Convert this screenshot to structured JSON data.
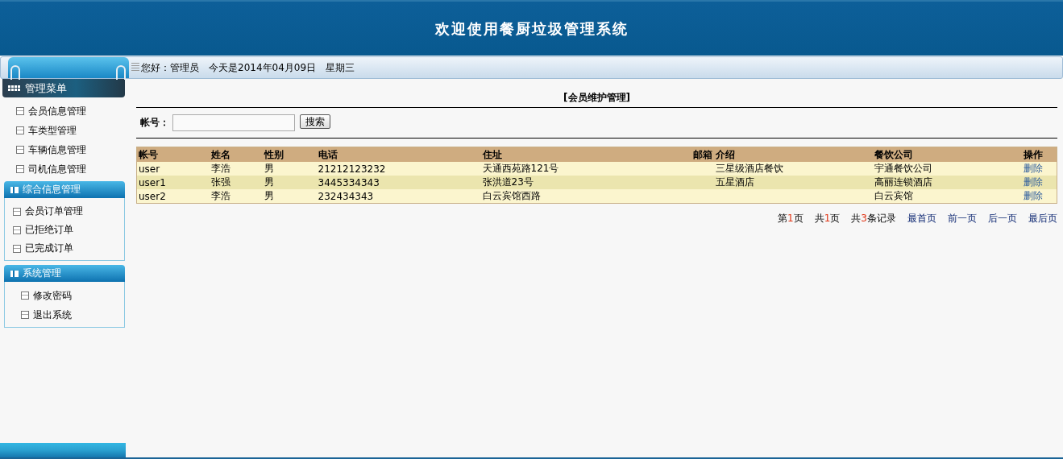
{
  "header": {
    "title": "欢迎使用餐厨垃圾管理系统"
  },
  "topbar": {
    "greeting": "您好：管理员",
    "date": "今天是2014年04月09日",
    "weekday": "星期三"
  },
  "sidebar": {
    "menu_title": "管理菜单",
    "items": [
      "会员信息管理",
      "车类型管理",
      "车辆信息管理",
      "司机信息管理"
    ],
    "sections": [
      {
        "title": "综合信息管理",
        "items": [
          "会员订单管理",
          "已拒绝订单",
          "已完成订单"
        ]
      },
      {
        "title": "系统管理",
        "items": [
          "修改密码",
          "退出系统"
        ]
      }
    ]
  },
  "main": {
    "title": "[会员维护管理]",
    "search": {
      "label": "帐号：",
      "button": "搜索"
    },
    "table": {
      "columns": [
        "帐号",
        "姓名",
        "性别",
        "电话",
        "住址",
        "邮箱",
        "介绍",
        "餐饮公司",
        "操作"
      ],
      "rows": [
        [
          "user",
          "李浩",
          "男",
          "21212123232",
          "天通西苑路121号",
          "",
          "三星级酒店餐饮",
          "宇通餐饮公司",
          "删除"
        ],
        [
          "user1",
          "张强",
          "男",
          "3445334343",
          "张洪道23号",
          "",
          "五星酒店",
          "高丽连锁酒店",
          "删除"
        ],
        [
          "user2",
          "李浩",
          "男",
          "232434343",
          "白云宾馆西路",
          "",
          "",
          "白云宾馆",
          "删除"
        ]
      ]
    },
    "pager": {
      "status": [
        {
          "before": "第",
          "count": "1",
          "after": "页"
        },
        {
          "before": "共",
          "count": "1",
          "after": "页"
        },
        {
          "before": "共",
          "count": "3",
          "after": "条记录"
        }
      ],
      "links": [
        "最首页",
        "前一页",
        "后一页",
        "最后页"
      ]
    }
  }
}
